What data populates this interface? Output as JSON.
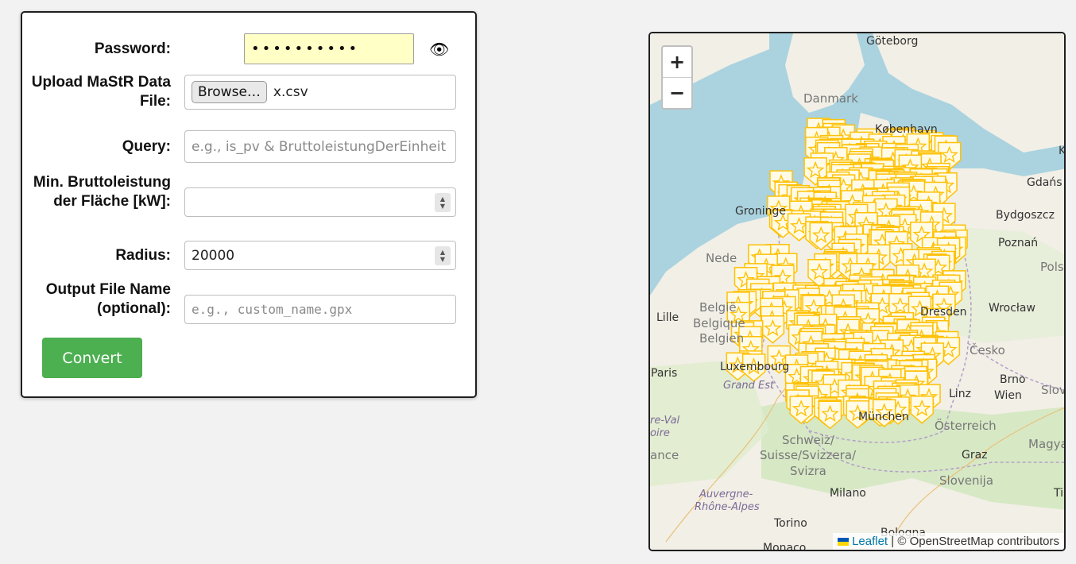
{
  "form": {
    "password_label": "Password:",
    "password_value": "••••••••••",
    "upload_label": "Upload MaStR Data File:",
    "browse_label": "Browse…",
    "file_name": "x.csv",
    "query_label": "Query:",
    "query_placeholder": "e.g., is_pv & BruttoleistungDerEinheit >",
    "min_label": "Min. Bruttoleistung der Fläche [kW]:",
    "min_value": "",
    "radius_label": "Radius:",
    "radius_value": "20000",
    "output_label": "Output File Name (optional):",
    "output_placeholder": "e.g., custom_name.gpx",
    "convert_label": "Convert"
  },
  "map": {
    "zoom_in": "+",
    "zoom_out": "−",
    "attribution_link": "Leaflet",
    "attribution_rest": "| © OpenStreetMap contributors",
    "marker_color": "#ffc107",
    "places": {
      "goteborg": "Göteborg",
      "danmark": "Danmark",
      "kobenhavn": "København",
      "gdansk": "Gdańs",
      "groninge": "Groninge",
      "bydgoszcz": "Bydgoszcz",
      "poznan": "Poznań",
      "nede": "Nede",
      "polska": "Pols",
      "belgie": "België",
      "belgique": "Belgique",
      "belgien": "Belgien",
      "lille": "Lille",
      "dresden": "Dresden",
      "wroclaw": "Wrocław",
      "cesko": "Česko",
      "paris": "Paris",
      "luxembourg": "Luxembourg",
      "brno": "Brno",
      "grandest": "Grand Est",
      "linz": "Linz",
      "wien": "Wien",
      "slov": "Slov",
      "munchen": "München",
      "osterreich": "Österreich",
      "magyar": "Magyar",
      "schweiz": "Schweiz/",
      "suisse": "Suisse/Svizzera/",
      "svizra": "Svizra",
      "graz": "Graz",
      "slovenija": "Slovenija",
      "milano": "Milano",
      "torino": "Torino",
      "bologna": "Bologna",
      "monaco": "Monaco",
      "auvergne": "Auvergne-",
      "rhone": "Rhône-Alpes",
      "ance": "ance",
      "reval": "re-Val",
      "oire": "oire",
      "ti": "Ti",
      "k": "K"
    }
  }
}
